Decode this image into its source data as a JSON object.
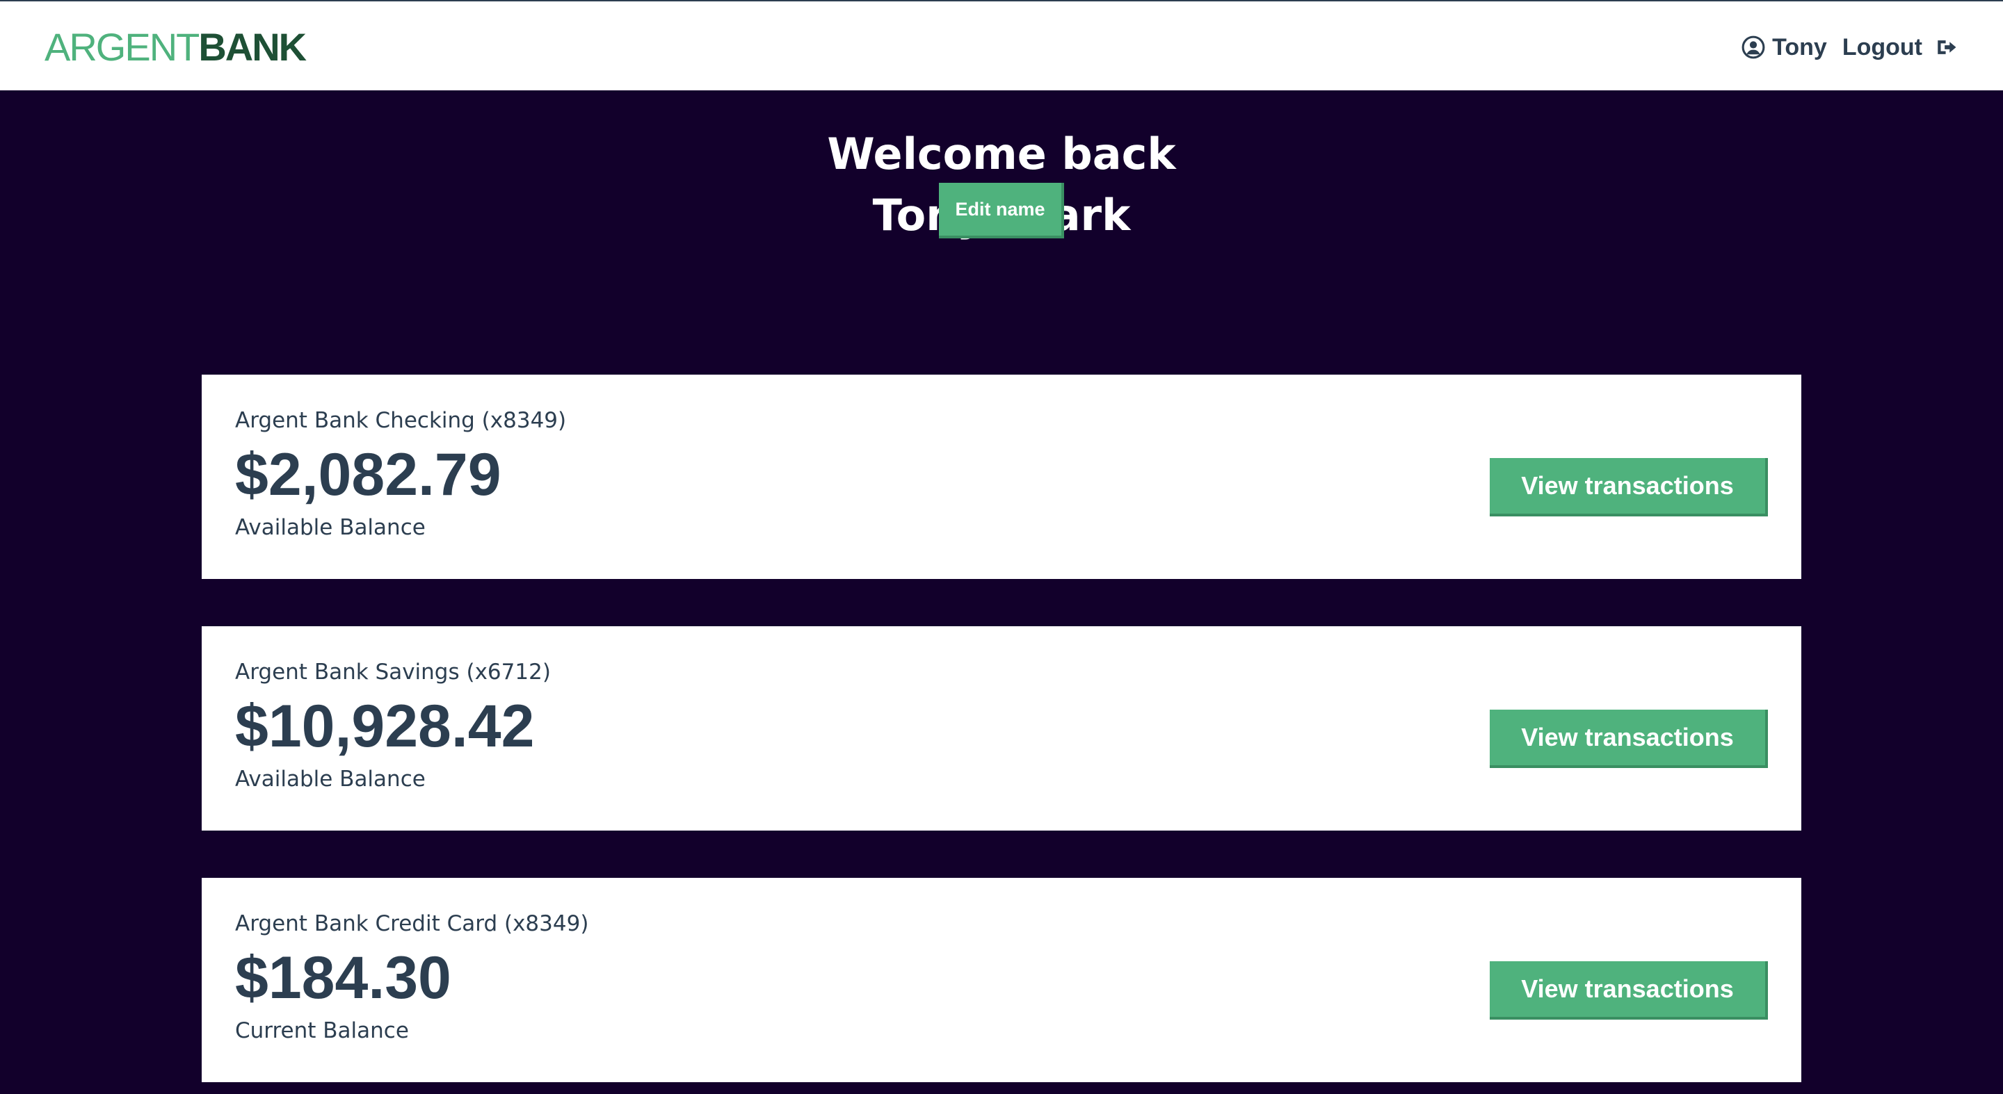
{
  "nav": {
    "logo_part1": "ARGENT",
    "logo_part2": "BANK",
    "user_label": "Tony",
    "logout_label": "Logout",
    "icons": {
      "user": "user-circle-icon",
      "logout": "sign-out-icon"
    }
  },
  "header": {
    "welcome_line1": "Welcome back",
    "welcome_line2": "Tony Stark",
    "edit_button": "Edit name"
  },
  "accounts": [
    {
      "title": "Argent Bank Checking (x8349)",
      "amount": "$2,082.79",
      "description": "Available Balance",
      "button": "View transactions"
    },
    {
      "title": "Argent Bank Savings (x6712)",
      "amount": "$10,928.42",
      "description": "Available Balance",
      "button": "View transactions"
    },
    {
      "title": "Argent Bank Credit Card (x8349)",
      "amount": "$184.30",
      "description": "Current Balance",
      "button": "View transactions"
    }
  ],
  "colors": {
    "background": "#12002b",
    "accent": "#4fb27d",
    "accent_dark": "#1e5035",
    "text": "#2c3e50"
  }
}
